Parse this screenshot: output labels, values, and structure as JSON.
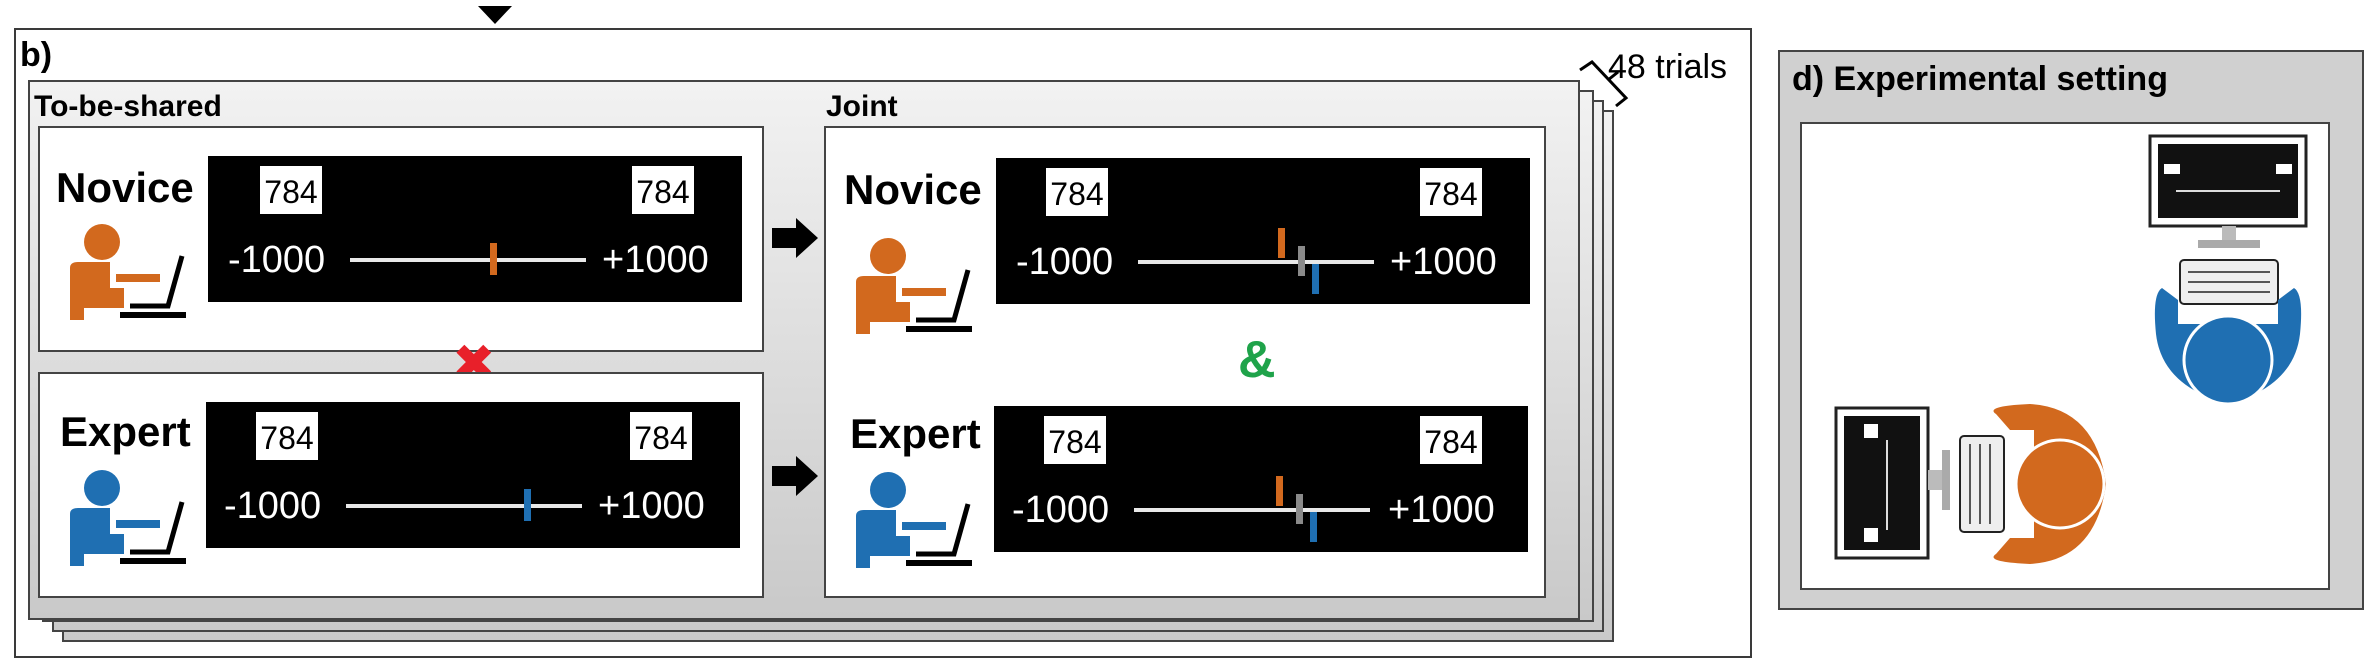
{
  "panel_b": {
    "label": "b)",
    "trials_label": "48 trials",
    "sections": {
      "to_be_shared": "To-be-shared",
      "joint": "Joint"
    },
    "roles": {
      "novice": "Novice",
      "expert": "Expert"
    },
    "number_value": "784",
    "scale_min": "-1000",
    "scale_max": "+1000",
    "joint_symbol": "&",
    "not_shared_symbol": "✖"
  },
  "panel_d": {
    "title": "d) Experimental setting"
  },
  "colors": {
    "novice": "#d2691e",
    "expert": "#1f6fb2",
    "mean_marker": "#8a8a8a",
    "cross": "#e8202a",
    "ampersand": "#1fa34a"
  }
}
